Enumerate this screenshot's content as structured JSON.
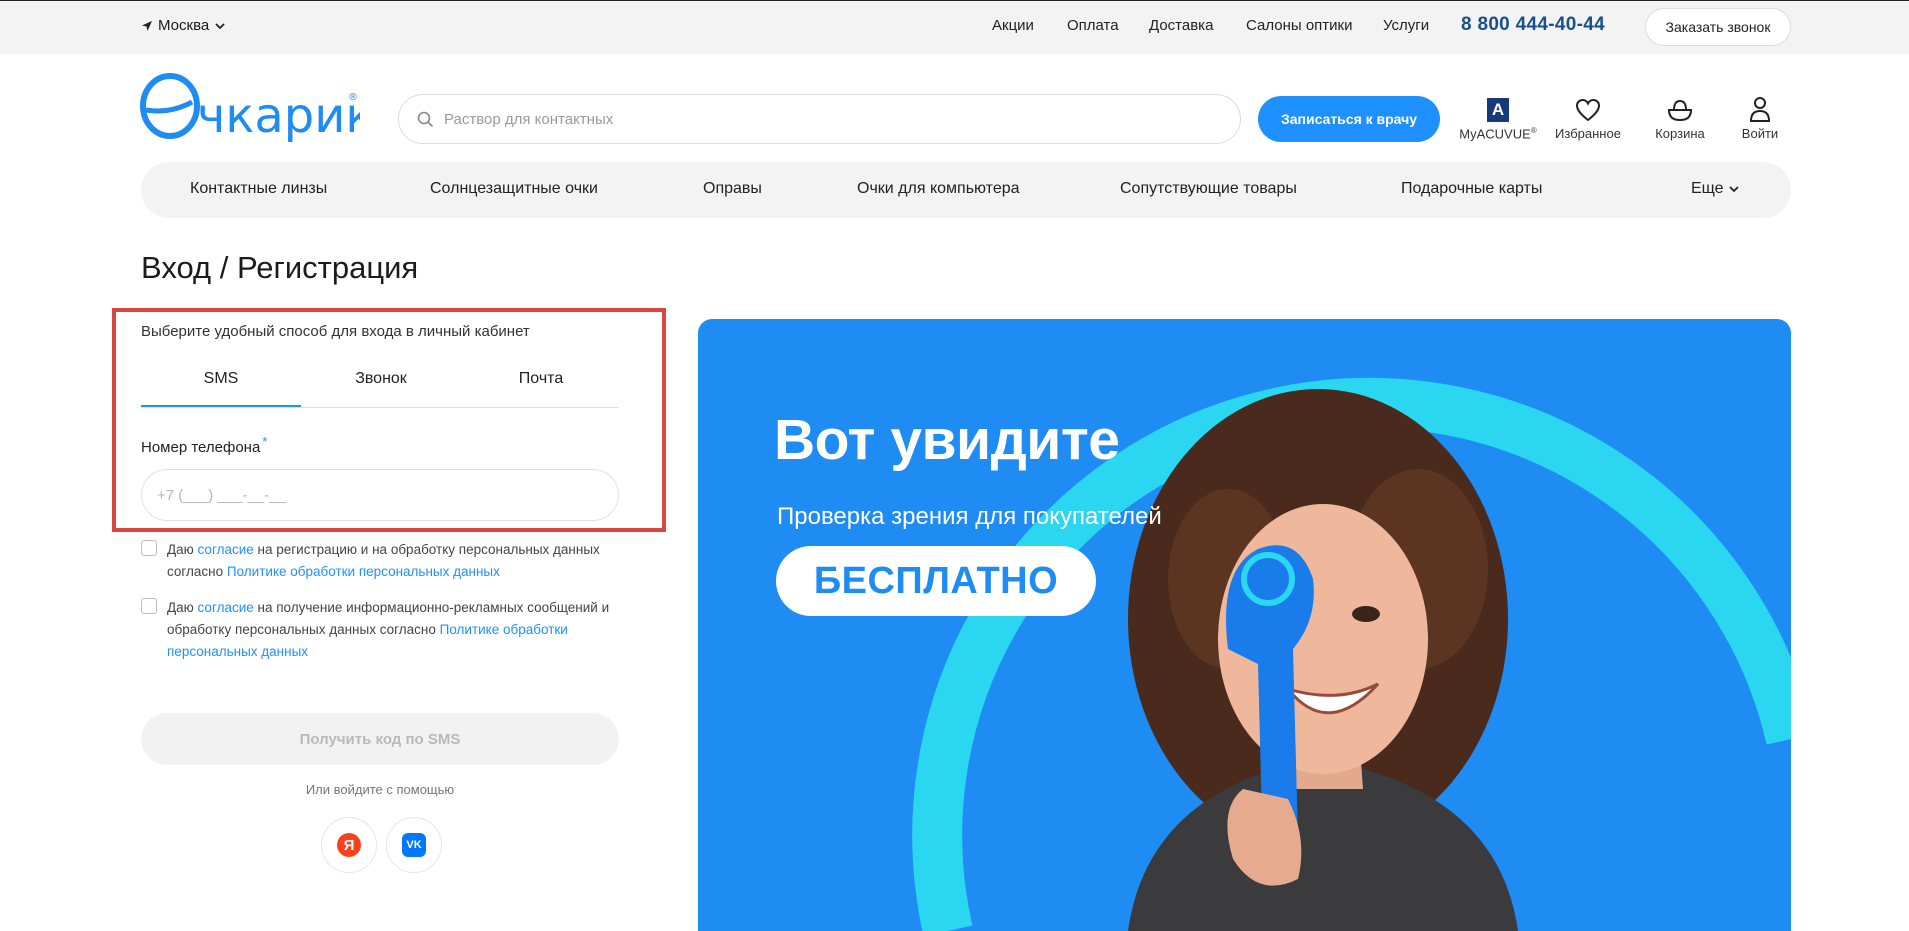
{
  "topbar": {
    "city": "Москва",
    "links": [
      "Акции",
      "Оплата",
      "Доставка",
      "Салоны оптики",
      "Услуги"
    ],
    "phone": "8 800 444-40-44",
    "callback_label": "Заказать звонок"
  },
  "header": {
    "logo_text": "Очкарик",
    "search_placeholder": "Раствор для контактных",
    "doctor_button": "Записаться к врачу",
    "icons": {
      "myacuvue": "MyACUVUE",
      "myacuvue_mark": "A",
      "favorites": "Избранное",
      "cart": "Корзина",
      "login": "Войти"
    }
  },
  "catnav": {
    "items": [
      "Контактные линзы",
      "Солнцезащитные очки",
      "Оправы",
      "Очки для компьютера",
      "Сопутствующие товары",
      "Подарочные карты"
    ],
    "more": "Еще"
  },
  "main": {
    "title": "Вход / Регистрация",
    "subtitle": "Выберите удобный способ для входа в личный кабинет",
    "tabs": [
      {
        "label": "SMS",
        "active": true
      },
      {
        "label": "Звонок",
        "active": false
      },
      {
        "label": "Почта",
        "active": false
      }
    ],
    "phone_label": "Номер телефона",
    "phone_required_mark": "*",
    "phone_placeholder": "+7 (___) ___-__-__",
    "phone_value": "",
    "consent1": {
      "before": "Даю ",
      "link1": "согласие",
      "middle": " на регистрацию и на обработку персональных данных согласно ",
      "link2": "Политике обработки персональных данных"
    },
    "consent2": {
      "before": "Даю ",
      "link1": "согласие",
      "middle": " на получение информационно-рекламных сообщений и обработку персональных данных согласно ",
      "link2": "Политике обработки персональных данных"
    },
    "sms_button": "Получить код по SMS",
    "or_text": "Или войдите с помощью",
    "social": {
      "yandex": "Я",
      "vk": "VK"
    }
  },
  "banner": {
    "title": "Вот увидите",
    "subtitle": "Проверка зрения для покупателей",
    "badge": "БЕСПЛАТНО"
  },
  "colors": {
    "accent": "#1e90ff",
    "brand_blue": "#1e8cf2",
    "phone_blue": "#1a4f8e",
    "highlight_red": "#d9473f"
  }
}
